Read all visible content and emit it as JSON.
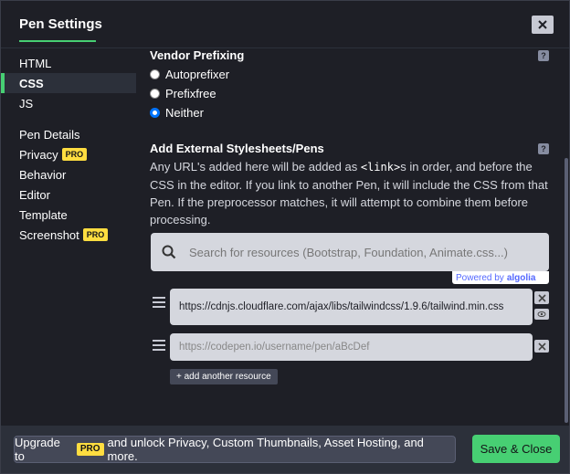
{
  "header": {
    "title": "Pen Settings"
  },
  "sidebar": {
    "group1": [
      {
        "label": "HTML"
      },
      {
        "label": "CSS",
        "active": true
      },
      {
        "label": "JS"
      }
    ],
    "group2": [
      {
        "label": "Pen Details"
      },
      {
        "label": "Privacy",
        "pro": "PRO"
      },
      {
        "label": "Behavior"
      },
      {
        "label": "Editor"
      },
      {
        "label": "Template"
      },
      {
        "label": "Screenshot",
        "pro": "PRO"
      }
    ]
  },
  "vendor": {
    "title": "Vendor Prefixing",
    "options": [
      "Autoprefixer",
      "Prefixfree",
      "Neither"
    ],
    "selected": "Neither"
  },
  "external": {
    "title": "Add External Stylesheets/Pens",
    "desc_part1": "Any URL's added here will be added as ",
    "desc_code": "<link>",
    "desc_part2": "s in order, and before the CSS in the editor. If you link to another Pen, it will include the CSS from that Pen. If the preprocessor matches, it will attempt to combine them before processing.",
    "search_placeholder": "Search for resources (Bootstrap, Foundation, Animate.css...)",
    "powered_by": "Powered by",
    "algolia": "algolia",
    "resources": [
      {
        "value": "https://cdnjs.cloudflare.com/ajax/libs/tailwindcss/1.9.6/tailwind.min.css"
      },
      {
        "placeholder": "https://codepen.io/username/pen/aBcDef"
      }
    ],
    "add_label": "+ add another resource"
  },
  "footer": {
    "upgrade_pre": "Upgrade to",
    "upgrade_pro": "PRO",
    "upgrade_post": "and unlock Privacy, Custom Thumbnails, Asset Hosting, and more.",
    "save_label": "Save & Close"
  },
  "colors": {
    "accent": "#47cf73",
    "pro_badge": "#ffdd40",
    "background": "#1e1f26"
  }
}
